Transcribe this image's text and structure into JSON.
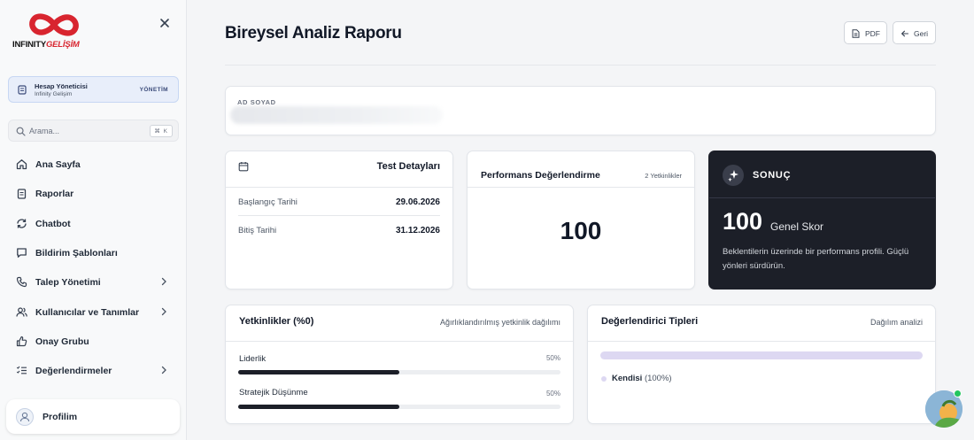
{
  "brand": {
    "logo_text_a": "INFINITY",
    "logo_text_b": "GELİŞİM",
    "accent": "#d8252f"
  },
  "sidebar": {
    "account": {
      "title": "Hesap Yöneticisi",
      "subtitle": "Infinity Gelişim",
      "role": "YÖNETİM"
    },
    "search": {
      "placeholder": "Arama...",
      "shortcut": "⌘ K"
    },
    "items": [
      {
        "label": "Ana Sayfa",
        "icon": "home-icon"
      },
      {
        "label": "Raporlar",
        "icon": "clipboard-icon"
      },
      {
        "label": "Chatbot",
        "icon": "refresh-icon"
      },
      {
        "label": "Bildirim Şablonları",
        "icon": "message-icon"
      },
      {
        "label": "Talep Yönetimi",
        "icon": "phone-icon",
        "has_chevron": true
      },
      {
        "label": "Kullanıcılar ve Tanımlar",
        "icon": "users-icon",
        "has_chevron": true
      },
      {
        "label": "Onay Grubu",
        "icon": "thumbs-up-icon"
      },
      {
        "label": "Değerlendirmeler",
        "icon": "list-check-icon",
        "has_chevron": true
      }
    ],
    "profile": {
      "label": "Profilim"
    }
  },
  "header": {
    "title": "Bireysel Analiz Raporu",
    "pdf_label": "PDF",
    "back_label": "Geri"
  },
  "name_card": {
    "label": "AD SOYAD"
  },
  "test_details": {
    "title": "Test Detayları",
    "rows": [
      {
        "key": "Başlangıç Tarihi",
        "value": "29.06.2026"
      },
      {
        "key": "Bitiş Tarihi",
        "value": "31.12.2026"
      }
    ]
  },
  "performance": {
    "title": "Performans Değerlendirme",
    "subtitle": "2 Yetkinlikler",
    "value": "100"
  },
  "result": {
    "title": "SONUÇ",
    "score": "100",
    "score_label": "Genel Skor",
    "description": "Beklentilerin üzerinde bir performans profili. Güçlü yönleri sürdürün."
  },
  "competencies": {
    "title": "Yetkinlikler (%0)",
    "subtitle": "Ağırlıklandırılmış yetkinlik dağılımı",
    "items": [
      {
        "name": "Liderlik",
        "percent_label": "50%",
        "fill": 0.5
      },
      {
        "name": "Stratejik Düşünme",
        "percent_label": "50%",
        "fill": 0.5
      }
    ]
  },
  "evaluators": {
    "title": "Değerlendirici Tipleri",
    "subtitle": "Dağılım analizi",
    "items": [
      {
        "name": "Kendisi",
        "percent_label": "(100%)",
        "fill": 1.0,
        "color": "#ddd8f2"
      }
    ]
  }
}
